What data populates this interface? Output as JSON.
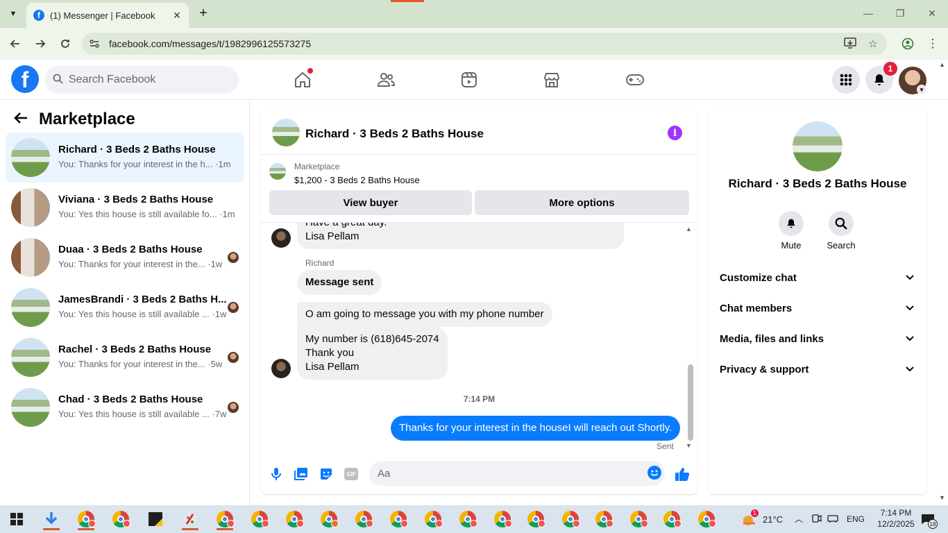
{
  "browser": {
    "tab_title": "(1) Messenger | Facebook",
    "url": "facebook.com/messages/t/1982996125573275"
  },
  "fb_header": {
    "search_placeholder": "Search Facebook",
    "notification_count": "1",
    "logo_letter": "f"
  },
  "left": {
    "title": "Marketplace",
    "conversations": [
      {
        "name": "Richard · 3 Beds 2 Baths House",
        "snippet": "You: Thanks for your interest in the h... ·1m",
        "thumb": "house",
        "active": true
      },
      {
        "name": "Viviana · 3 Beds 2 Baths House",
        "snippet": "You: Yes this house is still available fo... ·1m",
        "thumb": "kitchen",
        "active": false
      },
      {
        "name": "Duaa · 3 Beds 2 Baths House",
        "snippet": "You: Thanks for your interest in the... ·1w",
        "thumb": "kitchen",
        "active": false
      },
      {
        "name": "JamesBrandi · 3 Beds 2 Baths H...",
        "snippet": "You: Yes this house is still available ... ·1w",
        "thumb": "house",
        "active": false
      },
      {
        "name": "Rachel · 3 Beds 2 Baths House",
        "snippet": "You: Thanks for your interest in the... ·5w",
        "thumb": "house",
        "active": false
      },
      {
        "name": "Chad · 3 Beds 2 Baths House",
        "snippet": "You: Yes this house is still available ... ·7w",
        "thumb": "house",
        "active": false
      }
    ]
  },
  "chat": {
    "title": "Richard · 3 Beds 2 Baths House",
    "marketplace_label": "Marketplace",
    "listing": "$1,200 - 3 Beds 2 Baths House",
    "view_buyer": "View buyer",
    "more_options": "More options",
    "msg1_line1": "Have a great day.",
    "msg1_line2": "Lisa Pellam",
    "sender_name": "Richard",
    "msg2": "Message sent",
    "msg3": "O am going to message you with my phone number",
    "msg4_line1": "My number is (618)645-2074",
    "msg4_line2": "Thank you",
    "msg4_line3": "Lisa Pellam",
    "time": "7:14 PM",
    "outgoing": "Thanks for your interest in the houseI will reach out Shortly.",
    "sent_label": "Sent",
    "composer_placeholder": "Aa",
    "gif_label": "GIF"
  },
  "right_panel": {
    "title": "Richard · 3 Beds 2 Baths House",
    "mute_label": "Mute",
    "search_label": "Search",
    "rows": [
      "Customize chat",
      "Chat members",
      "Media, files and links",
      "Privacy & support"
    ]
  },
  "taskbar": {
    "temperature": "21°C",
    "language": "ENG",
    "time": "7:14 PM",
    "date": "12/2/2025",
    "weather_badge": "1",
    "notif_count": "18"
  },
  "colors": {
    "fb_blue": "#1877f2",
    "messenger_blue": "#0a7cff",
    "info_purple": "#a033ff",
    "notif_red": "#e41e3f"
  }
}
